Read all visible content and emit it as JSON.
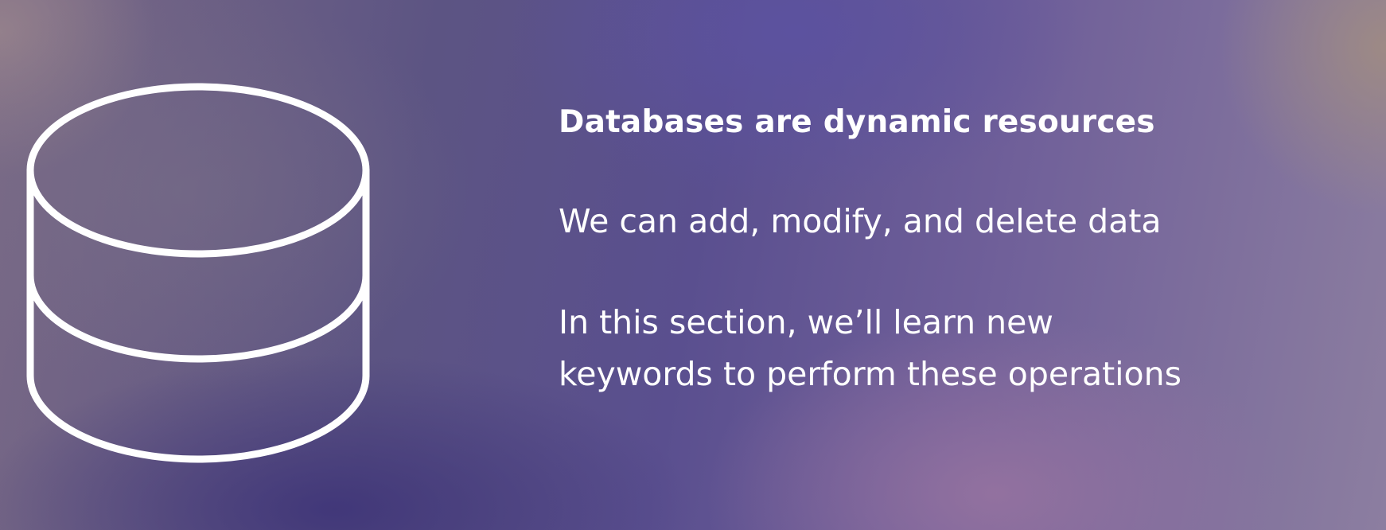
{
  "slide": {
    "heading": "Databases are dynamic resources",
    "paragraph_1": "We can add, modify, and delete data",
    "paragraph_2_lines": [
      "In this section, we’ll learn new",
      "keywords to perform these operations"
    ],
    "icon": "database-icon"
  },
  "colors": {
    "text": "#ffffff",
    "icon_stroke": "#ffffff"
  }
}
